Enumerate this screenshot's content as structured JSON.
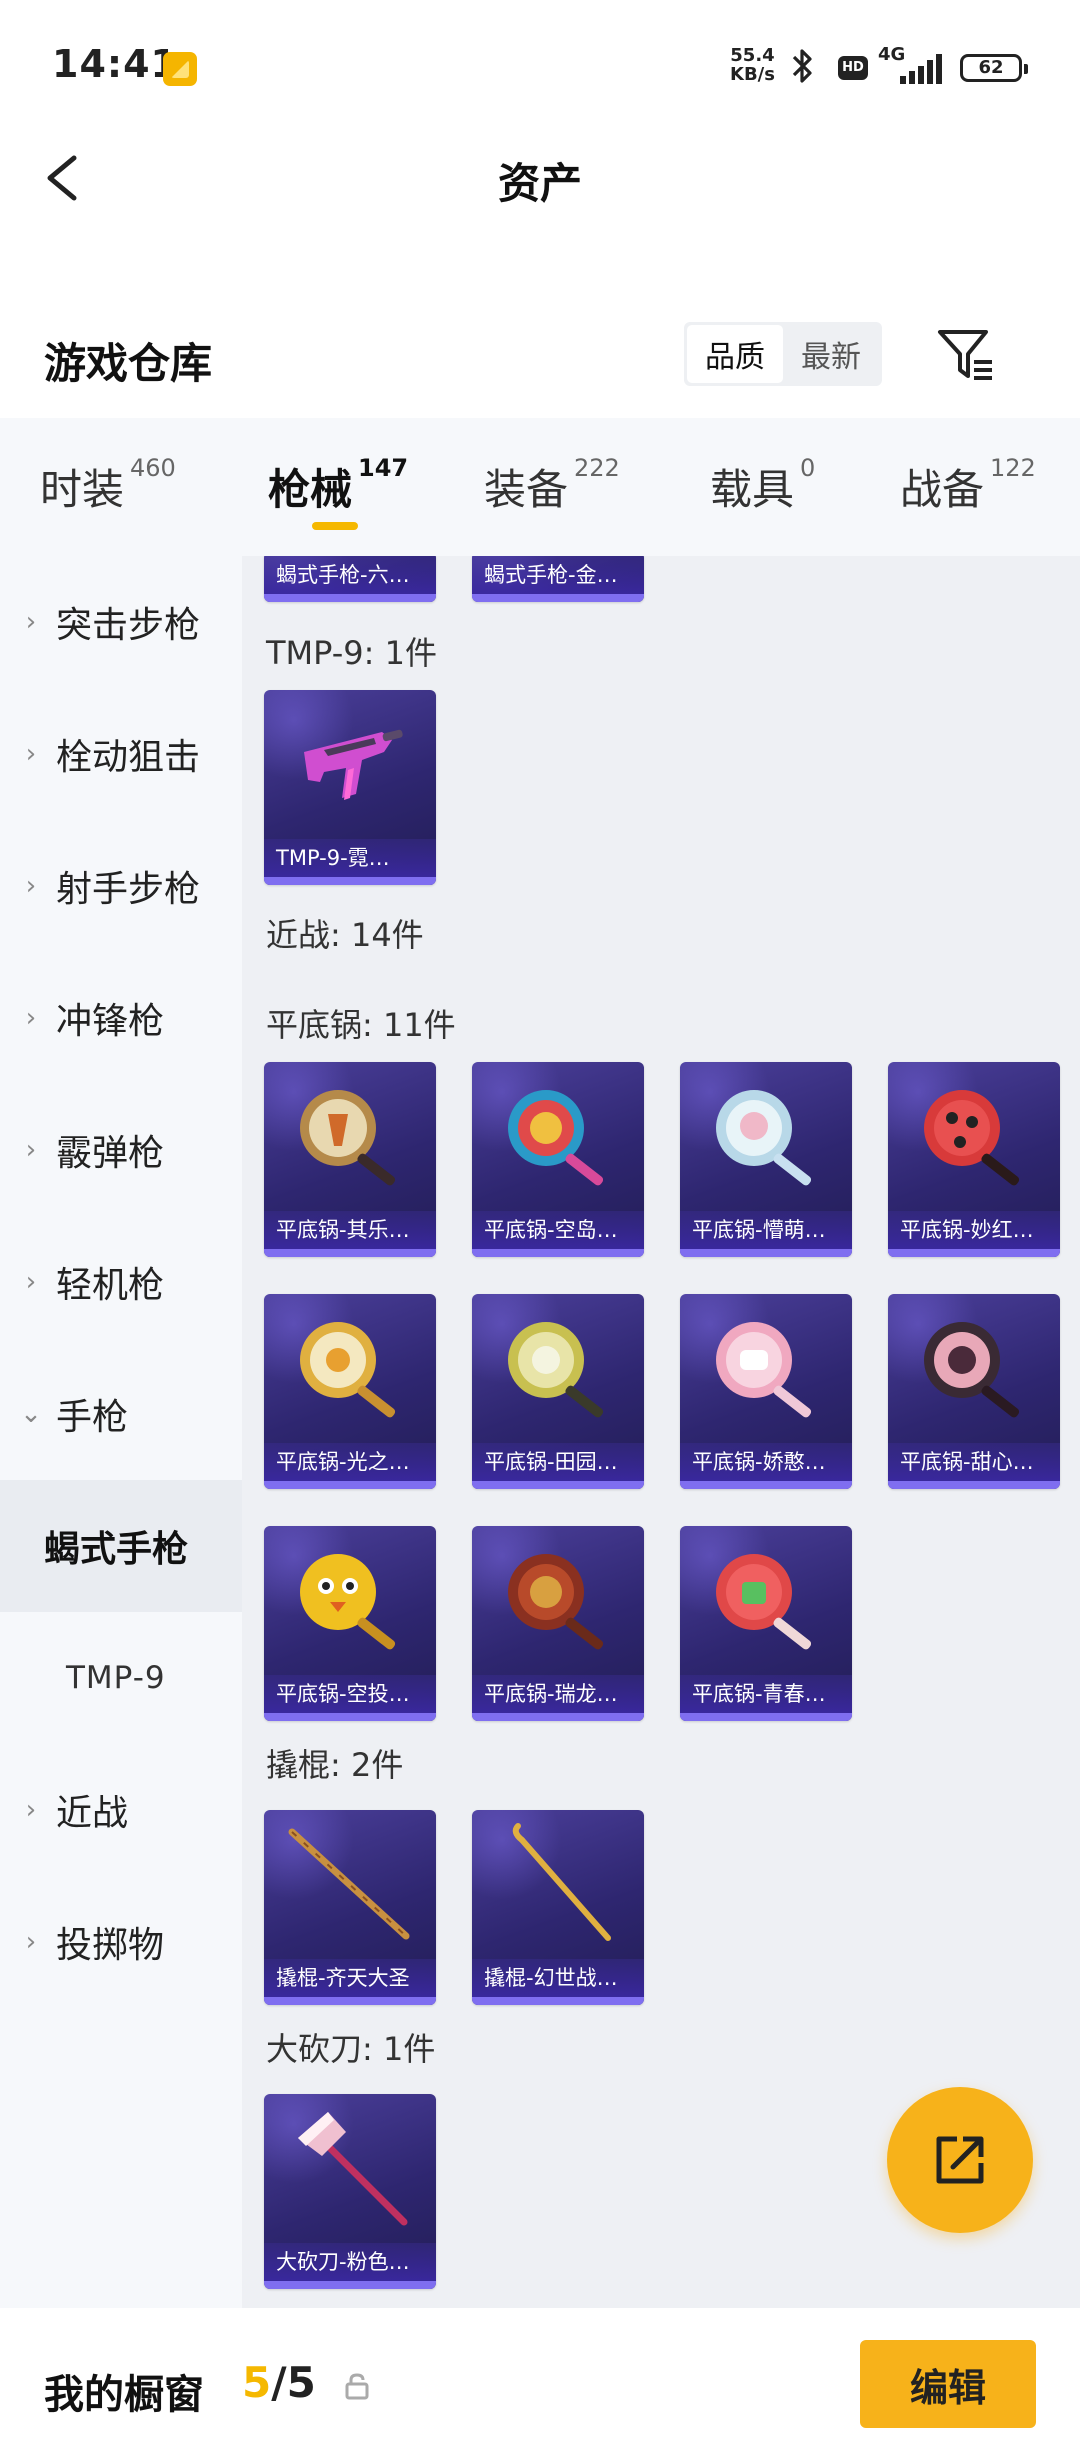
{
  "status_bar": {
    "time": "14:41",
    "net_speed_value": "55.4",
    "net_speed_unit": "KB/s",
    "hd": "HD",
    "net_type": "4G",
    "battery": "62"
  },
  "header": {
    "title": "资产"
  },
  "warehouse": {
    "title": "游戏仓库",
    "sort_options": [
      "品质",
      "最新"
    ],
    "active_sort": "品质"
  },
  "tabs": [
    {
      "label": "时装",
      "count": "460"
    },
    {
      "label": "枪械",
      "count": "147"
    },
    {
      "label": "装备",
      "count": "222"
    },
    {
      "label": "载具",
      "count": "0"
    },
    {
      "label": "战备",
      "count": "122"
    }
  ],
  "active_tab": "枪械",
  "sidebar": [
    {
      "label": "突击步枪",
      "chevron": "›"
    },
    {
      "label": "栓动狙击",
      "chevron": "›"
    },
    {
      "label": "射手步枪",
      "chevron": "›"
    },
    {
      "label": "冲锋枪",
      "chevron": "›"
    },
    {
      "label": "霰弹枪",
      "chevron": "›"
    },
    {
      "label": "轻机枪",
      "chevron": "›"
    },
    {
      "label": "手枪",
      "chevron": "⌄"
    },
    {
      "label": "蝎式手枪",
      "chevron": ""
    },
    {
      "label": "TMP-9",
      "chevron": ""
    },
    {
      "label": "近战",
      "chevron": "›"
    },
    {
      "label": "投掷物",
      "chevron": "›"
    }
  ],
  "sections": {
    "top_cards": [
      "蝎式手枪-六…",
      "蝎式手枪-金…"
    ],
    "tmp9": {
      "title": "TMP-9: 1件",
      "items": [
        "TMP-9-霓…"
      ]
    },
    "melee": {
      "title": "近战: 14件"
    },
    "pan": {
      "title": "平底锅: 11件",
      "items": [
        "平底锅-其乐…",
        "平底锅-空岛…",
        "平底锅-懵萌…",
        "平底锅-妙红…",
        "平底锅-光之…",
        "平底锅-田园…",
        "平底锅-娇憨…",
        "平底锅-甜心…",
        "平底锅-空投…",
        "平底锅-瑞龙…",
        "平底锅-青春…"
      ]
    },
    "crowbar": {
      "title": "撬棍: 2件",
      "items": [
        "撬棍-齐天大圣",
        "撬棍-幻世战…"
      ]
    },
    "machete": {
      "title": "大砍刀: 1件",
      "items": [
        "大砍刀-粉色…"
      ]
    }
  },
  "bottom": {
    "showcase_label": "我的橱窗",
    "showcase_current": "5",
    "showcase_total": "/5",
    "edit_label": "编辑"
  },
  "colors": {
    "accent": "#f5b800",
    "card_bg": "#2e2670",
    "card_bar": "#7f6ef0",
    "sidebar_bg": "#f6f8fb",
    "content_bg": "#eef0f4"
  }
}
